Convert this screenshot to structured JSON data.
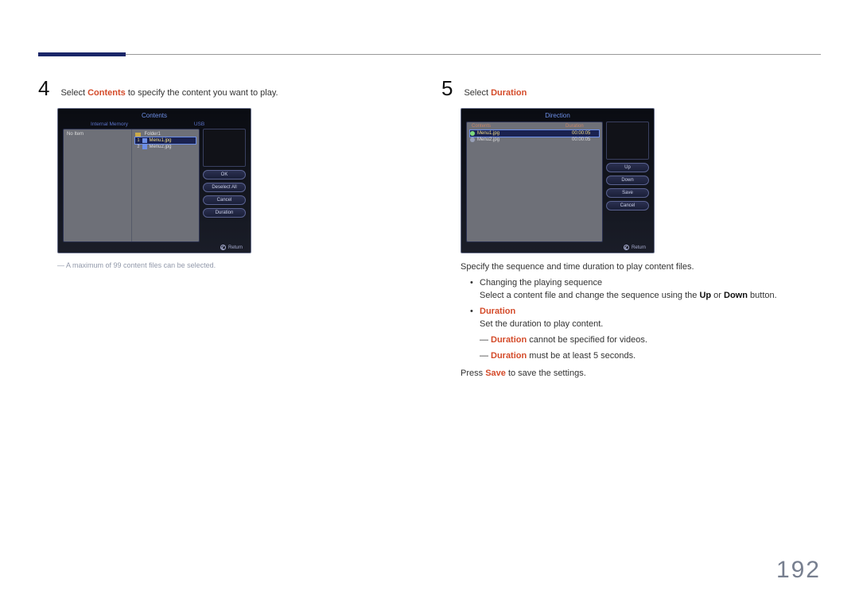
{
  "page_number": "192",
  "step4": {
    "num": "4",
    "text_prefix": "Select ",
    "text_bold": "Contents",
    "text_suffix": " to specify the content you want to play.",
    "note": "A maximum of 99 content files can be selected.",
    "ui": {
      "title": "Contents",
      "tab1": "Internal Memory",
      "tab2": "USB",
      "left_noitem": "No Item",
      "folder": "Folder1",
      "items": [
        {
          "n": "1",
          "name": "Menu1.jpg"
        },
        {
          "n": "2",
          "name": "Menu2.jpg"
        }
      ],
      "buttons": [
        "OK",
        "Deselect All",
        "Cancel",
        "Duration"
      ],
      "return": "Return"
    }
  },
  "step5": {
    "num": "5",
    "text_prefix": "Select ",
    "text_bold": "Duration",
    "ui": {
      "title": "Direction",
      "tab1": "Contents",
      "tab2": "Duration",
      "rows": [
        {
          "name": "Menu1.jpg",
          "dur": "00:00:05"
        },
        {
          "name": "Menu2.jpg",
          "dur": "00:00:05"
        }
      ],
      "buttons": [
        "Up",
        "Down",
        "Save",
        "Cancel"
      ],
      "return": "Return"
    },
    "p1": "Specify the sequence and time duration to play content files.",
    "b1": "Changing the playing sequence",
    "b1_sub_pre": "Select a content file and change the sequence using the ",
    "b1_up": "Up",
    "b1_or": " or ",
    "b1_down": "Down",
    "b1_suf": " button.",
    "b2_head": "Duration",
    "b2_line": "Set the duration to play content.",
    "b2_s1_bold": "Duration",
    "b2_s1_rest": " cannot be specified for videos.",
    "b2_s2_bold": "Duration",
    "b2_s2_rest": " must be at least 5 seconds.",
    "p2_pre": "Press ",
    "p2_bold": "Save",
    "p2_suf": " to save the settings."
  }
}
